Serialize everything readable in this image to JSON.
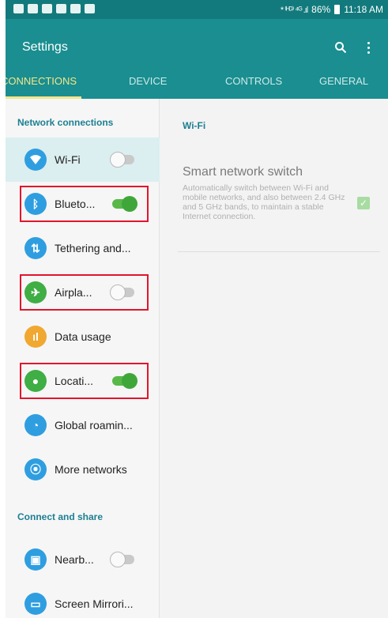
{
  "status_bar": {
    "signal_text": "* ⁽ᴴᴰ⁾ ⁴ᴳ .ıl",
    "battery": "86%",
    "time": "11:18 AM"
  },
  "app_bar": {
    "title": "Settings",
    "icons": [
      "search-icon",
      "more-vert-icon"
    ]
  },
  "tabs": [
    {
      "label": "CONNECTIONS",
      "active": true
    },
    {
      "label": "DEVICE",
      "active": false
    },
    {
      "label": "CONTROLS",
      "active": false
    },
    {
      "label": "GENERAL",
      "active": false
    }
  ],
  "sidebar": {
    "sections": [
      {
        "title": "Network connections"
      },
      {
        "title": "Connect and share"
      }
    ],
    "items": [
      {
        "label": "Wi-Fi",
        "icon": "wifi-icon",
        "toggle": "off",
        "selected": true
      },
      {
        "label": "Blueto...",
        "icon": "bluetooth-icon",
        "toggle": "on",
        "highlighted": true
      },
      {
        "label": "Tethering and...",
        "icon": "tethering-icon"
      },
      {
        "label": "Airpla...",
        "icon": "airplane-icon",
        "toggle": "off",
        "highlighted": true
      },
      {
        "label": "Data usage",
        "icon": "data-usage-icon"
      },
      {
        "label": "Locati...",
        "icon": "location-icon",
        "toggle": "on",
        "highlighted": true
      },
      {
        "label": "Global roamin...",
        "icon": "global-roaming-icon"
      },
      {
        "label": "More networks",
        "icon": "more-networks-icon"
      },
      {
        "label": "Nearb...",
        "icon": "nearby-icon",
        "toggle": "off"
      },
      {
        "label": "Screen Mirrori...",
        "icon": "screen-mirroring-icon"
      }
    ]
  },
  "detail": {
    "header": "Wi-Fi",
    "smart_switch": {
      "title": "Smart network switch",
      "description": "Automatically switch between Wi-Fi and mobile networks, and also between 2.4 GHz and 5 GHz bands, to maintain a stable Internet connection.",
      "checked": true
    }
  },
  "colors": {
    "status_bar": "#127a7c",
    "app_bar": "#1a8e90",
    "active_tab": "#f4e68a",
    "section_text": "#1d7f92",
    "toggle_on": "#3fa73a",
    "highlight_box": "#e2152b"
  }
}
